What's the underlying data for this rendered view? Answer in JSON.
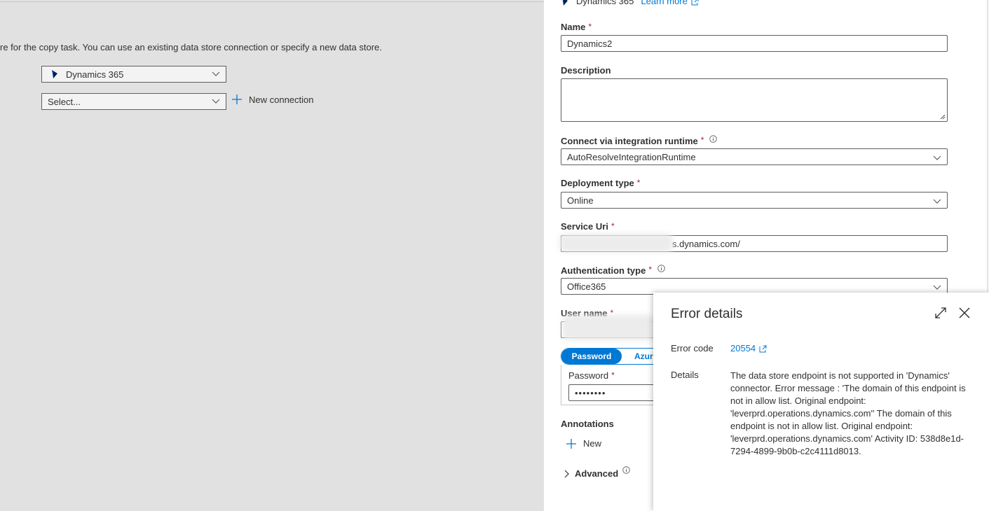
{
  "left": {
    "intro_text": "re for the copy task. You can use an existing data store connection or specify a new data store.",
    "store_dropdown_value": "Dynamics 365",
    "connection_dropdown_value": "Select...",
    "new_connection_label": "New connection"
  },
  "panel": {
    "header_store": "Dynamics 365",
    "learn_more": "Learn more",
    "name_label": "Name",
    "name_value": "Dynamics2",
    "description_label": "Description",
    "description_value": "",
    "runtime_label": "Connect via integration runtime",
    "runtime_value": "AutoResolveIntegrationRuntime",
    "deployment_label": "Deployment type",
    "deployment_value": "Online",
    "service_uri_label": "Service Uri",
    "service_uri_value": "s.dynamics.com/",
    "auth_label": "Authentication type",
    "auth_value": "Office365",
    "username_label": "User name",
    "toggle_password": "Password",
    "toggle_azure": "Azure",
    "password_label": "Password",
    "password_value": "••••••••",
    "annotations_label": "Annotations",
    "new_label": "New",
    "advanced_label": "Advanced",
    "required_marker": "*"
  },
  "error": {
    "title": "Error details",
    "code_label": "Error code",
    "code_value": "20554",
    "details_label": "Details",
    "details_text": "The data store endpoint is not supported in 'Dynamics' connector. Error message : 'The domain of this endpoint is not in allow list. Original endpoint: 'leverprd.operations.dynamics.com'' The domain of this endpoint is not in allow list. Original endpoint: 'leverprd.operations.dynamics.com' Activity ID: 538d8e1d-7294-4899-9b0b-c2c4111d8013."
  },
  "colors": {
    "accent": "#0078d4",
    "required": "#a4262c",
    "overlay": "#e1e1e1"
  },
  "icons": [
    "dynamics-icon",
    "chevron-down-icon",
    "plus-icon",
    "external-link-icon",
    "info-icon",
    "expand-icon",
    "close-icon",
    "chevron-right-icon"
  ]
}
